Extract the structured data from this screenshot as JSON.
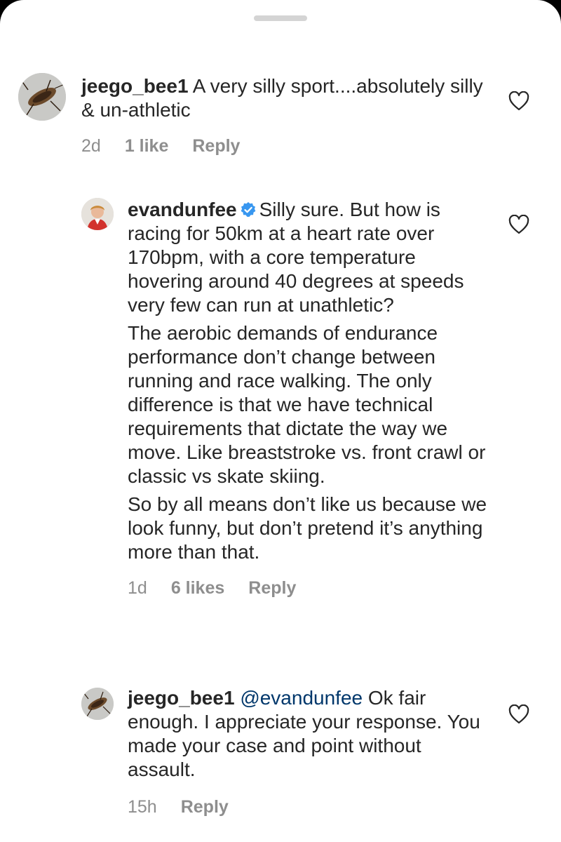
{
  "comments": [
    {
      "username": "jeego_bee1",
      "text": "A very silly sport....absolutely silly &  un-athletic",
      "time": "2d",
      "likes": "1 like",
      "reply": "Reply"
    },
    {
      "username": "evandunfee",
      "verified": true,
      "paragraphs": [
        "Silly sure. But how is racing for 50km at a heart rate over 170bpm, with a core temperature hovering around 40 degrees at speeds very few can run at unathletic?",
        "The aerobic demands of endurance performance don’t change between running and race walking. The only difference is that we have technical requirements that dictate the way we move. Like breaststroke vs. front crawl or classic vs skate skiing.",
        "So by all means don’t like us because we look funny, but don’t pretend it’s anything more than that."
      ],
      "time": "1d",
      "likes": "6 likes",
      "reply": "Reply"
    },
    {
      "username": "jeego_bee1",
      "mention": "@evandunfee",
      "text": "Ok fair enough. I appreciate your response. You made your case and point without assault.",
      "time": "15h",
      "reply": "Reply"
    }
  ],
  "colors": {
    "text": "#262626",
    "secondary": "#8e8e8e",
    "mention": "#00376b",
    "verified": "#3897f0",
    "grabber": "#d4d4d4"
  },
  "icons": {
    "like": "heart-outline-icon",
    "verified": "verified-badge-icon"
  }
}
